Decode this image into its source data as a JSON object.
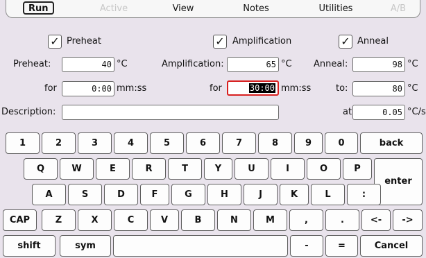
{
  "tabs": [
    {
      "label": "Run",
      "state": "active"
    },
    {
      "label": "Active",
      "state": "disabled"
    },
    {
      "label": "View",
      "state": "normal"
    },
    {
      "label": "Notes",
      "state": "normal"
    },
    {
      "label": "Utilities",
      "state": "normal"
    },
    {
      "label": "A/B",
      "state": "disabled"
    }
  ],
  "checks": {
    "preheat": {
      "label": "Preheat",
      "checked": true,
      "mark": "✓"
    },
    "amplification": {
      "label": "Amplification",
      "checked": true,
      "mark": "✓"
    },
    "anneal": {
      "label": "Anneal",
      "checked": true,
      "mark": "✓"
    }
  },
  "form": {
    "preheat_label": "Preheat:",
    "preheat_value": "40",
    "preheat_unit": "°C",
    "amp_label": "Amplification:",
    "amp_value": "65",
    "amp_unit": "°C",
    "anneal_label": "Anneal:",
    "anneal_value": "98",
    "anneal_unit": "°C",
    "for1_label": "for",
    "for1_value": "0:00",
    "for1_unit": "mm:ss",
    "for2_label": "for",
    "for2_value": "30:00",
    "for2_unit": "mm:ss",
    "to_label": "to:",
    "to_value": "80",
    "to_unit": "°C",
    "desc_label": "Description:",
    "desc_value": "",
    "at_label": "at",
    "at_value": "0.05",
    "at_unit": "°C/s"
  },
  "keyboard": {
    "row1": [
      "1",
      "2",
      "3",
      "4",
      "5",
      "6",
      "7",
      "8",
      "9",
      "0",
      "back"
    ],
    "row2": [
      "Q",
      "W",
      "E",
      "R",
      "T",
      "Y",
      "U",
      "I",
      "O",
      "P"
    ],
    "enter": "enter",
    "row3": [
      "A",
      "S",
      "D",
      "F",
      "G",
      "H",
      "J",
      "K",
      "L",
      ":"
    ],
    "row4": [
      "CAP",
      "Z",
      "X",
      "C",
      "V",
      "B",
      "N",
      "M",
      ",",
      ".",
      "<-",
      "->"
    ],
    "row5": {
      "shift": "shift",
      "sym": "sym",
      "space": "",
      "minus": "-",
      "equals": "=",
      "cancel": "Cancel"
    }
  }
}
